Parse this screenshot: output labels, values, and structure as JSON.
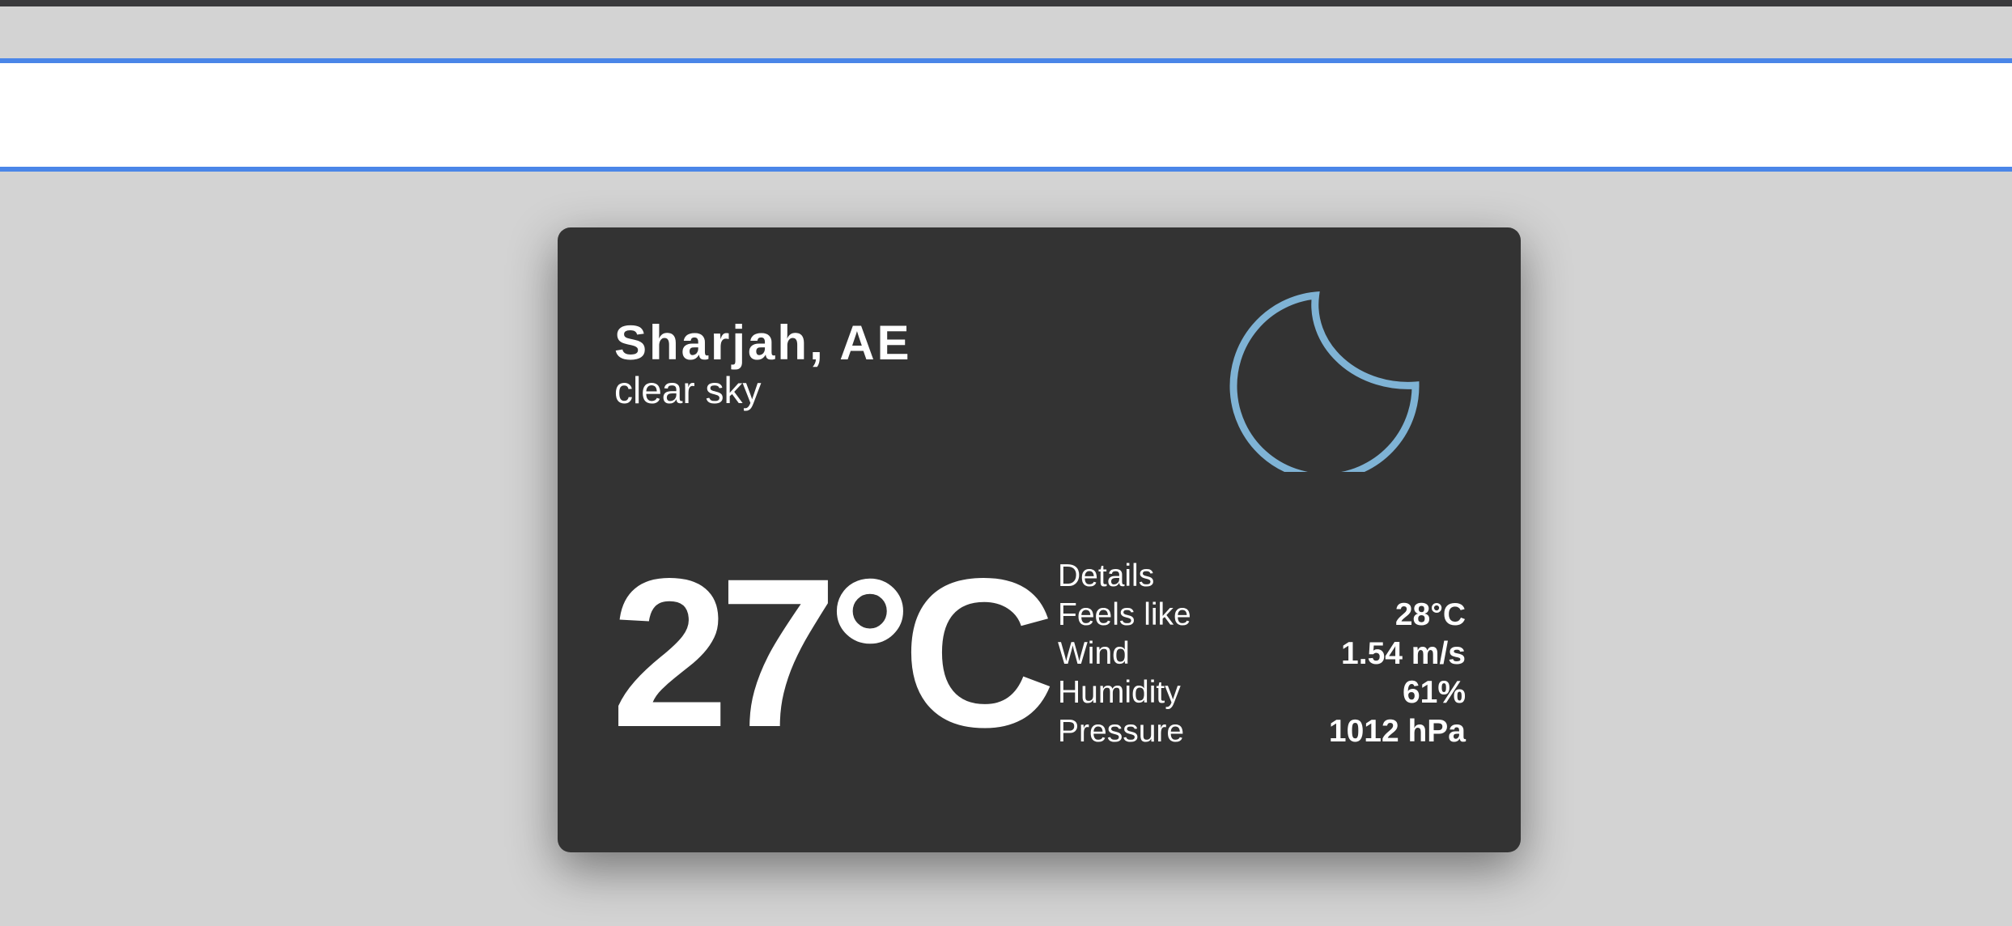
{
  "search": {
    "value": "",
    "placeholder": ""
  },
  "weather": {
    "city": "Sharjah, AE",
    "description": "clear sky",
    "temperature": "27°C",
    "icon": "crescent-moon-icon",
    "icon_color": "#7fb3d5",
    "details": {
      "title": "Details",
      "rows": [
        {
          "label": "Feels like",
          "value": "28°C"
        },
        {
          "label": "Wind",
          "value": "1.54 m/s"
        },
        {
          "label": "Humidity",
          "value": "61%"
        },
        {
          "label": "Pressure",
          "value": "1012 hPa"
        }
      ]
    }
  },
  "colors": {
    "background": "#d3d3d3",
    "card": "#333333",
    "search_border": "#4a86e8",
    "text": "#ffffff"
  }
}
